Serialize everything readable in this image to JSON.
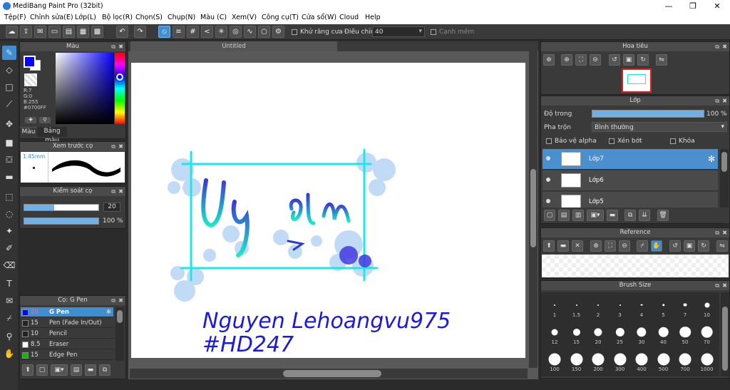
{
  "window": {
    "title": "MediBang Paint Pro (32bit)",
    "min_icon": "minimize-icon",
    "max_icon": "maximize-icon",
    "close_icon": "close-icon"
  },
  "menu": [
    "Tệp(F)",
    "Chỉnh sửa(E)",
    "Lớp(L)",
    "Bộ lọc(R)",
    "Chọn(S)",
    "Chụp(N)",
    "Màu (C)",
    "Xem(V)",
    "Công cụ(T)",
    "Cửa sổ(W)",
    "Cloud",
    "Help"
  ],
  "toolbar": {
    "antialias_label": "Khử răng cưa",
    "adjust_label": "Điều chỉnh",
    "adjust_value": "40",
    "sharp_label": "Cạnh mềm"
  },
  "color_panel": {
    "title": "Màu",
    "r": "R:7",
    "g": "G:0",
    "b": "B:255",
    "hex": "#0700FF",
    "tab_color": "Màu",
    "tab_palette": "Bảng màu",
    "fg_color": "#0700ff",
    "bg_color": "#ffffff"
  },
  "brush_preview": {
    "title": "Xem trước cọ",
    "size": "1.45mm"
  },
  "brush_control": {
    "title": "Kiểm soát cọ",
    "size_value": "20",
    "size_fraction": 0.4,
    "opacity_label": "100 %",
    "opacity_fraction": 1.0
  },
  "brush_list": {
    "title": "Cọ: G Pen",
    "items": [
      {
        "size": "20",
        "name": "G Pen",
        "color": "#0700ff"
      },
      {
        "size": "15",
        "name": "Pen (Fade In/Out)",
        "color": "#222222"
      },
      {
        "size": "10",
        "name": "Pencil",
        "color": "#222222"
      },
      {
        "size": "8.5",
        "name": "Eraser",
        "color": "#ffffff"
      },
      {
        "size": "15",
        "name": "Edge Pen",
        "color": "#00c000"
      }
    ]
  },
  "canvas": {
    "tab": "Untitled",
    "accent": "#2ee8e8",
    "text_line1": "Nguyen Lehoangvu975",
    "text_line2": "#HD247",
    "title_text": "Uy tín"
  },
  "navigator": {
    "title": "Hoa tiêu"
  },
  "layers": {
    "title": "Lớp",
    "opacity_label": "Độ trong",
    "opacity_value": "100 %",
    "blend_label": "Pha trộn",
    "blend_value": "Bình thường",
    "alpha_label": "Bảo vệ alpha",
    "clip_label": "Xén bớt",
    "lock_label": "Khóa",
    "items": [
      {
        "name": "Lớp7"
      },
      {
        "name": "Lớp6"
      },
      {
        "name": "Lớp5"
      }
    ]
  },
  "reference": {
    "title": "Reference"
  },
  "brush_size": {
    "title": "Brush Size",
    "sizes": [
      "1",
      "1.5",
      "2",
      "3",
      "4",
      "5",
      "7",
      "10",
      "12",
      "15",
      "20",
      "25",
      "30",
      "40",
      "50",
      "70",
      "100",
      "150",
      "200",
      "300",
      "400",
      "500",
      "700",
      "1000"
    ]
  }
}
